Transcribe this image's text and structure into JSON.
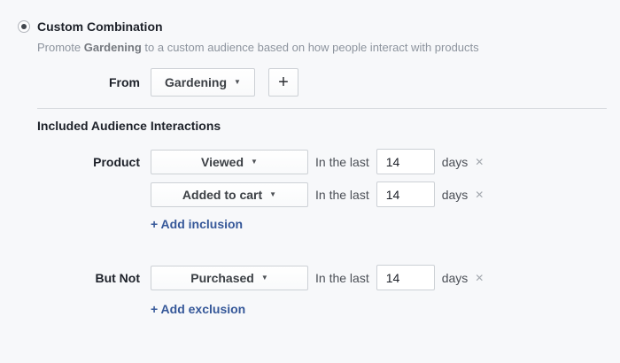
{
  "colors": {
    "background": "#f7f8fa",
    "text_primary": "#1d2129",
    "text_secondary": "#4b4f56",
    "text_muted": "#8d949e",
    "link_blue": "#365899",
    "control_border": "#ccd0d5",
    "divider": "#d8dbdf"
  },
  "icons": {
    "caret_down": "▼",
    "plus": "+",
    "remove": "✕"
  },
  "option": {
    "selected": true,
    "title": "Custom Combination",
    "description_prefix": "Promote",
    "description_highlight": "Gardening",
    "description_suffix": "to a custom audience based on how people interact with products"
  },
  "from_row": {
    "label": "From",
    "dropdown_value": "Gardening"
  },
  "included_section": {
    "heading": "Included Audience Interactions",
    "row_label": "Product",
    "rows": [
      {
        "dropdown_value": "Viewed",
        "prefix": "In the last",
        "days_value": "14",
        "suffix": "days"
      },
      {
        "dropdown_value": "Added to cart",
        "prefix": "In the last",
        "days_value": "14",
        "suffix": "days"
      }
    ],
    "add_link": "+ Add inclusion"
  },
  "excluded_section": {
    "row_label": "But Not",
    "rows": [
      {
        "dropdown_value": "Purchased",
        "prefix": "In the last",
        "days_value": "14",
        "suffix": "days"
      }
    ],
    "add_link": "+ Add exclusion"
  }
}
